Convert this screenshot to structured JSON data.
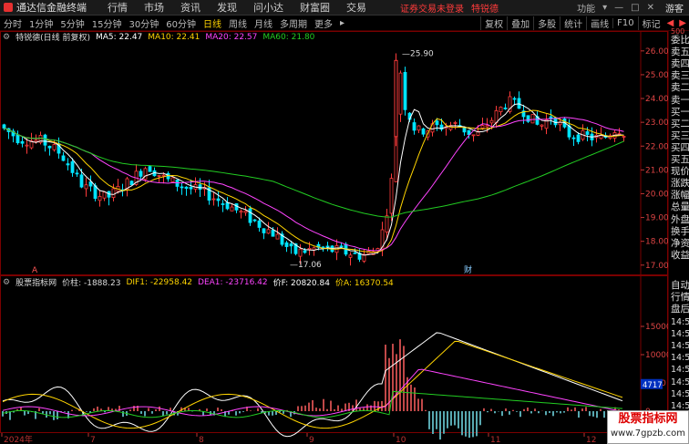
{
  "app": {
    "name": "通达信金融终端"
  },
  "menu": [
    "行情",
    "市场",
    "资讯",
    "发现",
    "问小达",
    "财富圈",
    "交易"
  ],
  "top_warning": "证券交易未登录",
  "stock_tag": "特锐德",
  "window_buttons": [
    "功能",
    "▾",
    "—",
    "□",
    "✕"
  ],
  "guest_label": "游客",
  "periods": [
    "分时",
    "1分钟",
    "5分钟",
    "15分钟",
    "30分钟",
    "60分钟",
    "日线",
    "周线",
    "月线",
    "多周期",
    "更多"
  ],
  "active_period": "日线",
  "tools": [
    "复权",
    "叠加",
    "多股",
    "统计",
    "画线",
    "F10",
    "标记"
  ],
  "upper_legend": {
    "title": "特锐德(日线 前复权)",
    "ma5": "MA5: 22.47",
    "ma10": "MA10: 22.41",
    "ma20": "MA20: 22.57",
    "ma60": "MA60: 21.80"
  },
  "lower_legend": {
    "title": "股票指标网",
    "v1": "价柱: -1888.23",
    "v2": "DIF1: -22958.42",
    "v3": "DEA1: -23716.42",
    "v4": "价F: 20820.84",
    "v5": "价A: 16370.54"
  },
  "price_axis": [
    "26.00",
    "25.00",
    "24.00",
    "23.00",
    "22.00",
    "21.00",
    "20.00",
    "19.00",
    "18.00",
    "17.00"
  ],
  "indicator_axis": [
    "15000",
    "10000",
    "5000",
    "0"
  ],
  "indicator_marker": "4717",
  "x_axis": [
    "2024年",
    "7",
    "8",
    "9",
    "10",
    "11",
    "12"
  ],
  "annotations": {
    "high": "25.90",
    "low": "17.06",
    "event": "财",
    "small_label": "A"
  },
  "right_panel_upper": [
    "委比",
    "卖五",
    "卖四",
    "卖三",
    "卖二",
    "卖一",
    "买一",
    "买二",
    "买三",
    "买四",
    "买五",
    "现价",
    "涨跌",
    "涨幅",
    "总量",
    "外盘",
    "换手",
    "净资",
    "收益"
  ],
  "right_panel_lower": [
    "自动",
    "行情",
    "盘后",
    "14:50",
    "14:50",
    "14:50",
    "14:50",
    "14:50",
    "14:50",
    "14:50",
    "14:50"
  ],
  "right_panel_top_num": "500",
  "watermark": {
    "line1": "股票指标网",
    "line2": "www.7gpzb.com"
  },
  "colors": {
    "up": "#ff3b3b",
    "down": "#00e4ff",
    "ma5": "#ffffff",
    "ma10": "#ffd400",
    "ma20": "#ff44ff",
    "ma60": "#22cc22"
  }
}
